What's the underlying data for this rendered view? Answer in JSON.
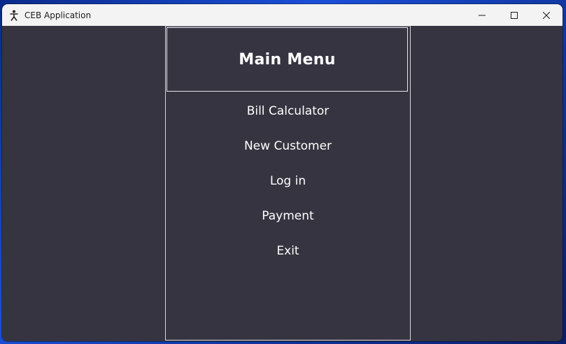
{
  "window": {
    "title": "CEB Application",
    "app_icon": "person-tower-icon",
    "controls": {
      "minimize": "minimize-icon",
      "maximize": "maximize-icon",
      "close": "close-icon"
    }
  },
  "menu": {
    "title": "Main Menu",
    "items": [
      {
        "label": "Bill Calculator"
      },
      {
        "label": "New Customer"
      },
      {
        "label": "Log in"
      },
      {
        "label": "Payment"
      },
      {
        "label": "Exit"
      }
    ]
  },
  "colors": {
    "background": "#353440",
    "titlebar": "#f3f3f3",
    "text": "#ffffff",
    "desktop_accent": "#1b4fd8"
  }
}
